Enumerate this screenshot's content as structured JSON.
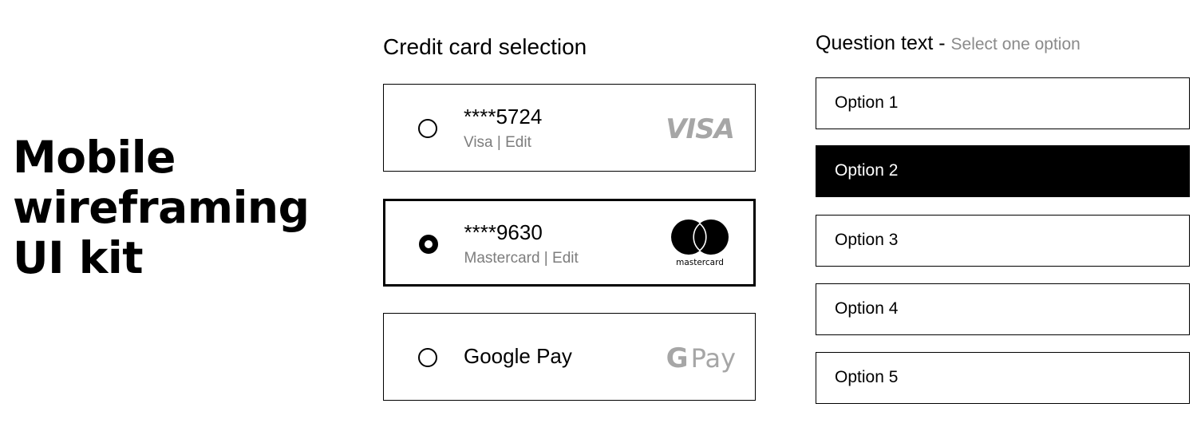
{
  "hero": {
    "title_lines": [
      "Mobile",
      "wireframing",
      "UI kit"
    ]
  },
  "credit_card_selection": {
    "title": "Credit card selection",
    "cards": [
      {
        "number": "****5724",
        "subtitle": "Visa | Edit",
        "logo": "visa-logo",
        "logo_text": "VISA",
        "selected": false
      },
      {
        "number": "****9630",
        "subtitle": "Mastercard | Edit",
        "logo": "mastercard-logo",
        "logo_text": "mastercard",
        "selected": true
      },
      {
        "number": "Google Pay",
        "subtitle": "",
        "logo": "google-pay-logo",
        "logo_text": "G Pay",
        "selected": false
      }
    ]
  },
  "question": {
    "title": "Question text - ",
    "hint": "Select one option",
    "options": [
      {
        "label": "Option 1",
        "selected": false
      },
      {
        "label": "Option 2",
        "selected": true
      },
      {
        "label": "Option 3",
        "selected": false
      },
      {
        "label": "Option 4",
        "selected": false
      },
      {
        "label": "Option 5",
        "selected": false
      }
    ]
  },
  "colors": {
    "text": "#000000",
    "muted_text": "#7d7d7d",
    "logo_gray": "#a6a6a6",
    "selected_bg": "#000000",
    "selected_text": "#ffffff",
    "background": "#ffffff"
  }
}
